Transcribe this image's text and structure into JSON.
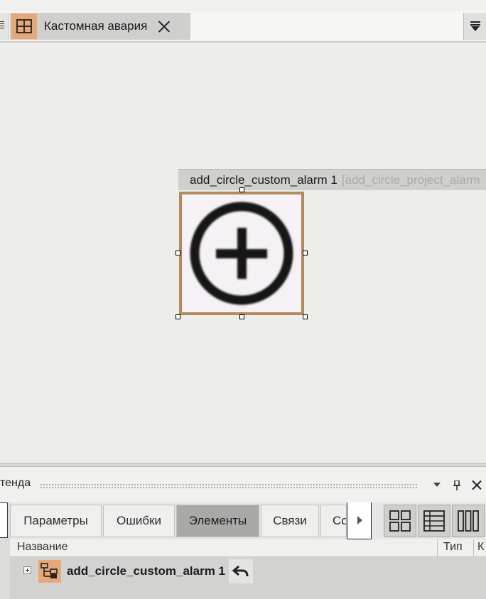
{
  "document_tab": {
    "title": "Кастомная авария",
    "icon": "grid-table-icon"
  },
  "canvas": {
    "element_name": "add_circle_custom_alarm 1",
    "element_type": "[add_circle_project_alarm",
    "element_icon": "add-circle-icon",
    "frame_color": "#b28a5c"
  },
  "panel": {
    "title": "тенда",
    "tabs": [
      {
        "label": "Параметры"
      },
      {
        "label": "Ошибки"
      },
      {
        "label": "Элементы",
        "active": true
      },
      {
        "label": "Связи"
      },
      {
        "label": "Со"
      }
    ],
    "columns": {
      "name": "Название",
      "type": "Тип",
      "extra": "К"
    },
    "tree": [
      {
        "label": "add_circle_custom_alarm 1",
        "icon": "element-node-icon",
        "action_icon": "undo-arrow-icon"
      }
    ]
  },
  "colors": {
    "accent_orange": "#e6a878",
    "active_tab": "#a9a9a7"
  }
}
